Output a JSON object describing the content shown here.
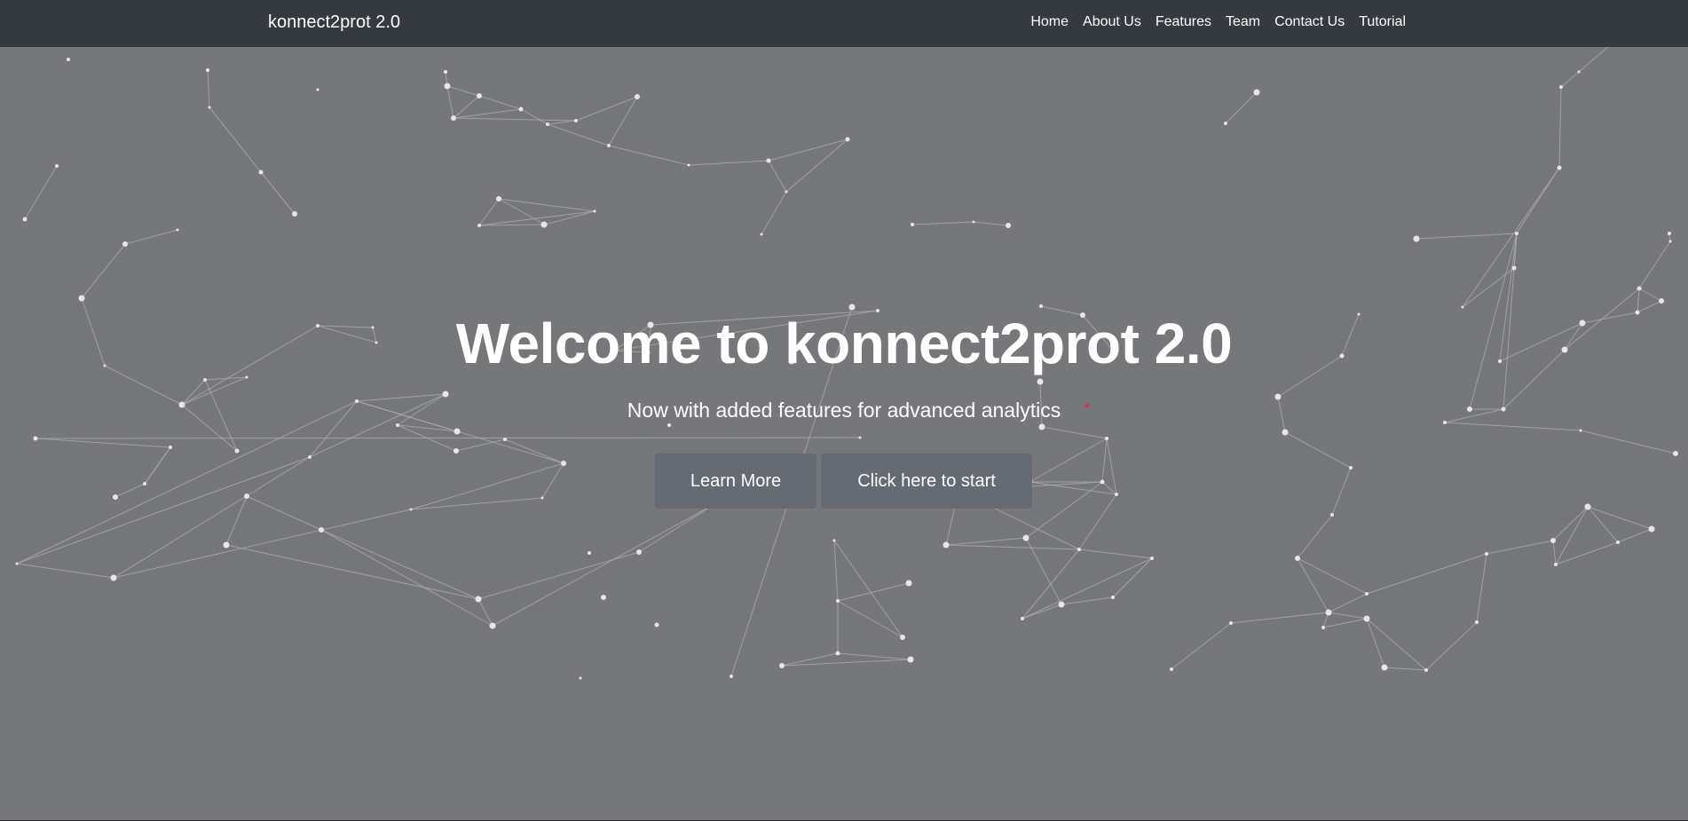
{
  "navbar": {
    "brand": "konnect2prot 2.0",
    "links": [
      {
        "label": "Home"
      },
      {
        "label": "About Us"
      },
      {
        "label": "Features"
      },
      {
        "label": "Team"
      },
      {
        "label": "Contact Us"
      },
      {
        "label": "Tutorial"
      }
    ]
  },
  "hero": {
    "title": "Welcome to konnect2prot 2.0",
    "subtitle": "Now with added features for advanced analytics",
    "buttons": {
      "learn_more": "Learn More",
      "start": "Click here to start"
    }
  },
  "colors": {
    "navbar_bg": "#343a40",
    "hero_bg": "#76777a",
    "button_bg": "#646b75",
    "text": "#ffffff",
    "network_node": "#e6e6e6",
    "network_edge": "#a9aaac",
    "accent_dot": "#e0312d"
  }
}
